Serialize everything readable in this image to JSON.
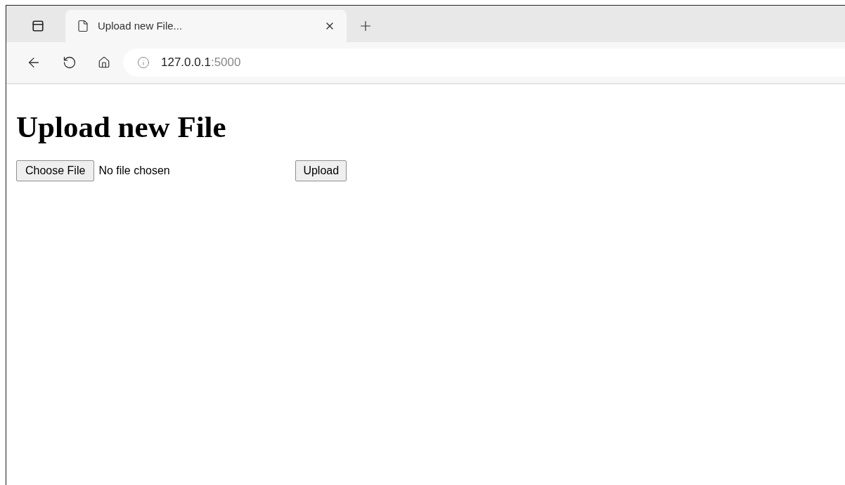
{
  "browser": {
    "tabs": [
      {
        "title": "Upload new File...",
        "selected": true
      }
    ],
    "address": {
      "host": "127.0.0.1",
      "port": ":5000"
    }
  },
  "page": {
    "heading": "Upload new File",
    "file_input": {
      "button": "Choose File",
      "status": "No file chosen"
    },
    "submit": "Upload"
  }
}
